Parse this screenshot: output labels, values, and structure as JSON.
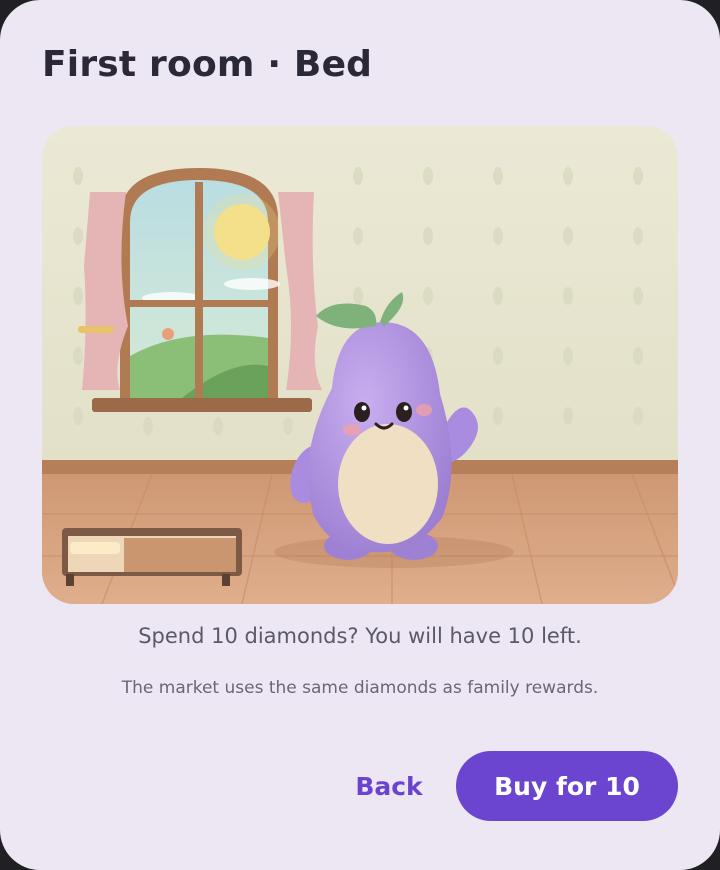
{
  "dialog": {
    "title": "First room · Bed",
    "confirm_text": "Spend 10 diamonds? You will have 10 left.",
    "note_text": "The market uses the same diamonds as family rewards.",
    "back_label": "Back",
    "buy_label": "Buy for 10"
  },
  "colors": {
    "accent": "#6b45d0",
    "back_text": "#6a44cc",
    "dialog_bg": "#ece7f3",
    "wall": "#e8e6d3",
    "floor": "#d9a683",
    "mascot": "#b497e0"
  },
  "illustration": {
    "scene": "room-with-window-and-bed",
    "character": "purple-eggplant-mascot"
  }
}
